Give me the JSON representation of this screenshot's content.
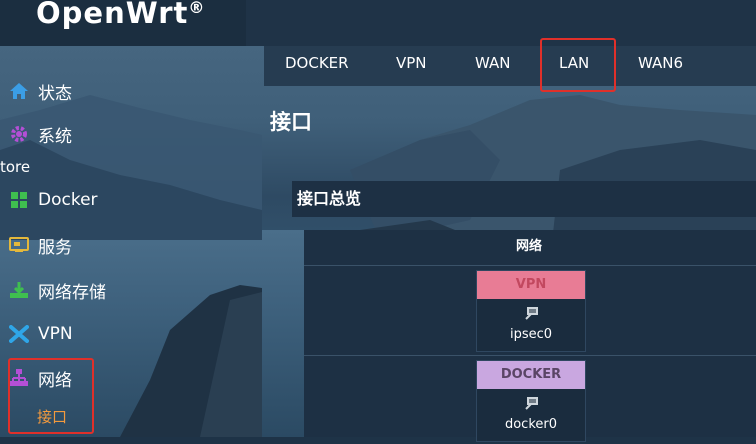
{
  "brand": {
    "name": "OpenWrt",
    "reg": "®"
  },
  "sidebar": {
    "items": [
      {
        "label": "状态",
        "icon": "home-icon",
        "color": "#3b9ee6"
      },
      {
        "label": "系统",
        "icon": "gear-icon",
        "color": "#b44fd6"
      },
      {
        "label": "Docker",
        "icon": "docker-grid-icon",
        "color": "#3fbf4f"
      },
      {
        "label": "服务",
        "icon": "services-icon",
        "color": "#e4b83b"
      },
      {
        "label": "网络存储",
        "icon": "download-tray-icon",
        "color": "#3fbf4f"
      },
      {
        "label": "VPN",
        "icon": "vpn-cross-icon",
        "color": "#2fa6e8"
      },
      {
        "label": "网络",
        "icon": "network-tree-icon",
        "color": "#b44fd6"
      }
    ],
    "store_label": "tore",
    "sub_item": "接口"
  },
  "tabs": [
    "DOCKER",
    "VPN",
    "WAN",
    "LAN",
    "WAN6"
  ],
  "page": {
    "title": "接口",
    "section": "接口总览",
    "table_header": "网络",
    "rows": [
      {
        "badge": "VPN",
        "badge_color": "#e87c95",
        "badge_text_color": "#c2485f",
        "device": "ipsec0"
      },
      {
        "badge": "DOCKER",
        "badge_color": "#c9a7e0",
        "badge_text_color": "#5a4566",
        "device": "docker0"
      }
    ]
  }
}
